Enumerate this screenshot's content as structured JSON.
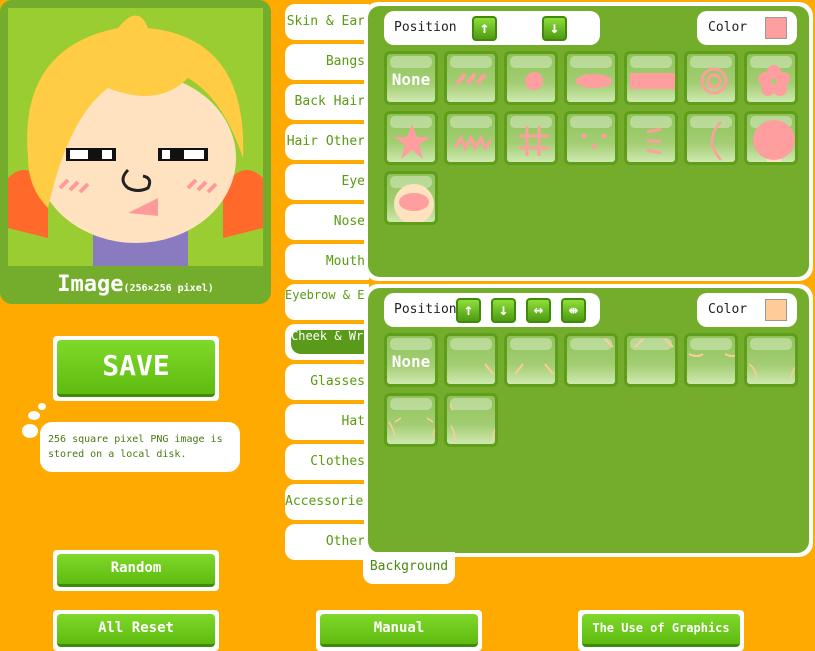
{
  "image_panel": {
    "caption": "Image",
    "caption_sub": "(256×256 pixel)"
  },
  "tabs": [
    {
      "label": "Skin & Ear"
    },
    {
      "label": "Bangs"
    },
    {
      "label": "Back Hair"
    },
    {
      "label": "Hair Other"
    },
    {
      "label": "Eye"
    },
    {
      "label": "Nose"
    },
    {
      "label": "Mouth"
    },
    {
      "label": "Eyebrow & Eyelash"
    },
    {
      "label": "Cheek & Wrinkle",
      "active": true
    },
    {
      "label": "Glasses"
    },
    {
      "label": "Hat"
    },
    {
      "label": "Clothes"
    },
    {
      "label": "Accessories"
    },
    {
      "label": "Other"
    }
  ],
  "background_tab": "Background",
  "top_panel": {
    "position_label": "Position",
    "color_label": "Color",
    "color": "#ff9e9e",
    "arrows": [
      "up",
      "down"
    ],
    "items": [
      "none",
      "slashes",
      "dot",
      "ellipse",
      "rectangle",
      "spiral",
      "flower",
      "star",
      "zigzag",
      "hash",
      "dots",
      "lines",
      "arc",
      "head-top",
      "head-mouth"
    ],
    "none_label": "None"
  },
  "bottom_panel": {
    "position_label": "Position",
    "color_label": "Color",
    "color": "#ffcc99",
    "arrows": [
      "up",
      "down",
      "widen",
      "narrow"
    ],
    "items": [
      "none",
      "wrinkle-right",
      "wrinkle-both",
      "wrinkle-top-right",
      "wrinkle-top-both",
      "wrinkle-eyes",
      "wrinkle-sides",
      "wrinkle-cheeks",
      "wrinkle-corners"
    ],
    "none_label": "None"
  },
  "buttons": {
    "save": "SAVE",
    "random": "Random",
    "all_reset": "All Reset",
    "manual": "Manual",
    "graphics": "The Use of Graphics"
  },
  "save_hint": "256 square pixel PNG image is stored on a local disk.",
  "colors": {
    "background": "#ffaa00",
    "panel": "#74ad2b",
    "accent": "#5fbb10"
  }
}
